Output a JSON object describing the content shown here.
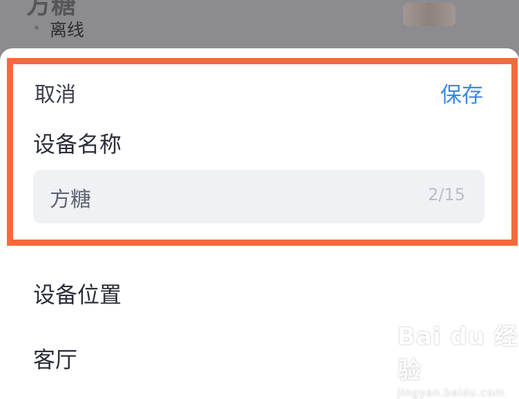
{
  "background": {
    "device_name": "方糖",
    "status": "离线"
  },
  "sheet": {
    "cancel_label": "取消",
    "save_label": "保存",
    "name_section_label": "设备名称",
    "name_value": "方糖",
    "name_counter": "2/15",
    "location_section_label": "设备位置",
    "location_value": "客厅"
  },
  "watermark": {
    "text": "Bai du 经验",
    "url": "jingyan.baidu.com"
  },
  "colors": {
    "accent": "#3b87e6",
    "highlight_border": "#f46a3a",
    "input_bg": "#f0f1f4",
    "backdrop": "#8c8c90"
  }
}
